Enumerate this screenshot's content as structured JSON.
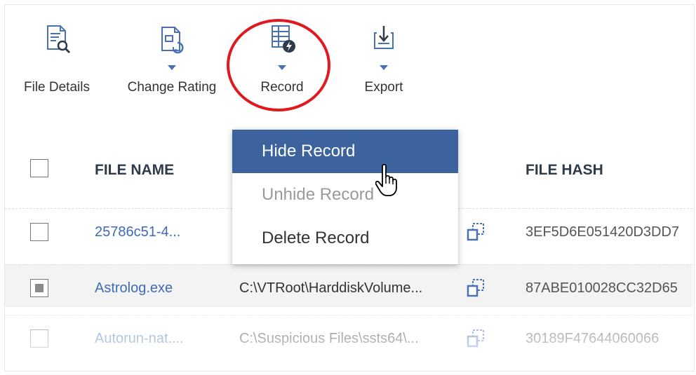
{
  "toolbar": {
    "file_details": {
      "label": "File Details",
      "icon": "file-search-icon"
    },
    "change_rating": {
      "label": "Change Rating",
      "icon": "file-rating-icon"
    },
    "record": {
      "label": "Record",
      "icon": "record-lightning-icon"
    },
    "export": {
      "label": "Export",
      "icon": "export-download-icon"
    }
  },
  "colors": {
    "accent": "#3d639e",
    "link": "#3e6bb6",
    "annotation": "#e0191f"
  },
  "table": {
    "headers": {
      "file_name": "FILE NAME",
      "file_hash": "FILE HASH"
    },
    "rows": [
      {
        "name": "25786c51-4...",
        "path": "",
        "hash": "3EF5D6E051420D3DD7",
        "checked": false
      },
      {
        "name": "Astrolog.exe",
        "path": "C:\\VTRoot\\HarddiskVolume...",
        "hash": "87ABE010028CC32D65",
        "checked": true
      },
      {
        "name": "Autorun-nat....",
        "path": "C:\\Suspicious Files\\ssts64\\...",
        "hash": "30189F47644060066",
        "checked": false
      }
    ]
  },
  "record_menu": {
    "items": [
      {
        "label": "Hide Record",
        "state": "active"
      },
      {
        "label": "Unhide Record",
        "state": "disabled"
      },
      {
        "label": "Delete Record",
        "state": "enabled"
      }
    ]
  }
}
